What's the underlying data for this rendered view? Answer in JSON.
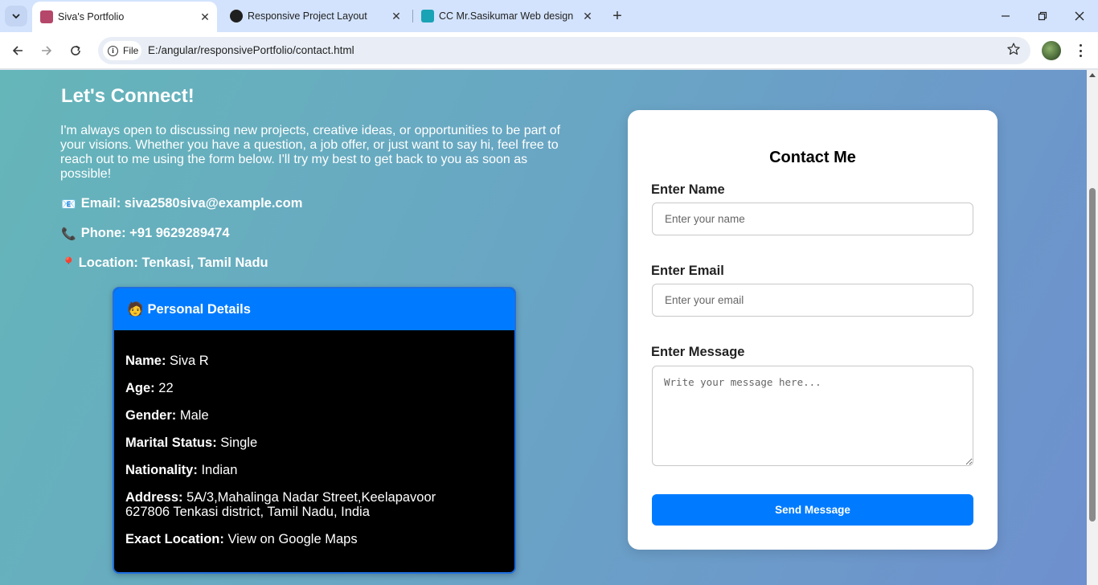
{
  "browser": {
    "tabs": [
      {
        "title": "Siva's Portfolio",
        "active": true
      },
      {
        "title": "Responsive Project Layout",
        "active": false
      },
      {
        "title": "CC Mr.Sasikumar Web designing",
        "active": false
      }
    ],
    "site_chip": "File",
    "url": "E:/angular/responsivePortfolio/contact.html"
  },
  "intro": {
    "heading": "Let's Connect!",
    "paragraph": "I'm always open to discussing new projects, creative ideas, or opportunities to be part of your visions. Whether you have a question, a job offer, or just want to say hi, feel free to reach out to me using the form below. I'll try my best to get back to you as soon as possible!",
    "email": "Email: siva2580siva@example.com",
    "phone": "Phone: +91 9629289474",
    "location": "Location: Tenkasi, Tamil Nadu"
  },
  "personal": {
    "title": "Personal Details",
    "rows": [
      {
        "label": "Name:",
        "value": "Siva R"
      },
      {
        "label": "Age:",
        "value": "22"
      },
      {
        "label": "Gender:",
        "value": "Male"
      },
      {
        "label": "Marital Status:",
        "value": "Single"
      },
      {
        "label": "Nationality:",
        "value": "Indian"
      },
      {
        "label": "Address:",
        "value": "5A/3,Mahalinga Nadar Street,Keelapavoor 627806 Tenkasi district, Tamil Nadu, India"
      },
      {
        "label": "Exact Location:",
        "value": "View on Google Maps"
      }
    ]
  },
  "form": {
    "title": "Contact Me",
    "name_label": "Enter Name",
    "name_placeholder": "Enter your name",
    "email_label": "Enter Email",
    "email_placeholder": "Enter your email",
    "message_label": "Enter Message",
    "message_placeholder": "Write your message here...",
    "submit_label": "Send Message"
  },
  "colors": {
    "accent": "#007bff",
    "card_dark": "#000000",
    "gradient_start": "#65b6b9",
    "gradient_end": "#6e90ce"
  },
  "icons": {
    "email": "envelope-icon",
    "phone": "telephone-icon",
    "location": "round-pushpin-icon",
    "personal": "person-icon"
  }
}
